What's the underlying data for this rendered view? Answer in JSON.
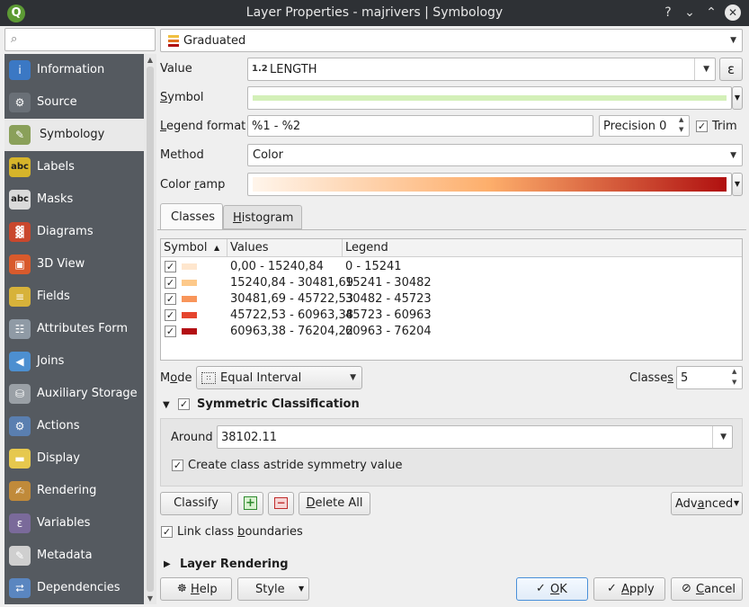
{
  "window": {
    "title": "Layer Properties - majrivers | Symbology",
    "logo_letter": "Q",
    "help_glyph": "?",
    "min_glyph": "⌄",
    "max_glyph": "⌃",
    "close_glyph": "✕"
  },
  "search": {
    "icon": "⌕",
    "placeholder": ""
  },
  "sidebar": {
    "items": [
      {
        "label": "Information",
        "icon": "info-icon",
        "glyph": "i",
        "color": "#3b78c4"
      },
      {
        "label": "Source",
        "icon": "source-icon",
        "glyph": "⚙",
        "color": "#6a7077"
      },
      {
        "label": "Symbology",
        "icon": "symbology-icon",
        "glyph": "✎",
        "color": "#8aa05a"
      },
      {
        "label": "Labels",
        "icon": "labels-icon",
        "glyph": "abc",
        "color": "#d6b42a"
      },
      {
        "label": "Masks",
        "icon": "masks-icon",
        "glyph": "abc",
        "color": "#dadada"
      },
      {
        "label": "Diagrams",
        "icon": "diagrams-icon",
        "glyph": "▓",
        "color": "#c9472d"
      },
      {
        "label": "3D View",
        "icon": "3d-view-icon",
        "glyph": "▣",
        "color": "#d85a2c"
      },
      {
        "label": "Fields",
        "icon": "fields-icon",
        "glyph": "≡",
        "color": "#d7b23a"
      },
      {
        "label": "Attributes Form",
        "icon": "attributes-form-icon",
        "glyph": "☷",
        "color": "#8f9aa5"
      },
      {
        "label": "Joins",
        "icon": "joins-icon",
        "glyph": "◀",
        "color": "#4d8fd0"
      },
      {
        "label": "Auxiliary Storage",
        "icon": "auxiliary-storage-icon",
        "glyph": "⛁",
        "color": "#9aa0a6"
      },
      {
        "label": "Actions",
        "icon": "actions-icon",
        "glyph": "⚙",
        "color": "#5a7fb0"
      },
      {
        "label": "Display",
        "icon": "display-icon",
        "glyph": "▬",
        "color": "#e6c84e"
      },
      {
        "label": "Rendering",
        "icon": "rendering-icon",
        "glyph": "✍",
        "color": "#c08a3a"
      },
      {
        "label": "Variables",
        "icon": "variables-icon",
        "glyph": "ε",
        "color": "#7a6a9a"
      },
      {
        "label": "Metadata",
        "icon": "metadata-icon",
        "glyph": "✎",
        "color": "#cfcfcf"
      },
      {
        "label": "Dependencies",
        "icon": "dependencies-icon",
        "glyph": "⮂",
        "color": "#5a86c0"
      }
    ],
    "active_index": 2
  },
  "renderer": {
    "value": "Graduated"
  },
  "value_field": {
    "label": "Value",
    "type_prefix": "1.2",
    "value": "LENGTH",
    "expr_glyph": "ε"
  },
  "symbol": {
    "label": "Symbol",
    "color": "#d3f0b8"
  },
  "legend_format": {
    "label": "Legend format",
    "value": "%1 - %2",
    "precision_label": "Precision 0",
    "trim_label": "Trim",
    "trim_checked": true
  },
  "method": {
    "label": "Method",
    "value": "Color"
  },
  "color_ramp": {
    "label": "Color ramp",
    "start": "#fff5eb",
    "mid": "#fdae6b",
    "end": "#b01010"
  },
  "tabs": [
    {
      "label": "Classes",
      "active": true
    },
    {
      "label": "Histogram",
      "active": false
    }
  ],
  "table": {
    "headers": [
      "Symbol",
      "Values",
      "Legend"
    ],
    "sort_glyph": "▲",
    "rows": [
      {
        "values": "0,00 - 15240,84",
        "legend": "0 - 15241",
        "color": "#fee6ce"
      },
      {
        "values": "15240,84 - 30481,69",
        "legend": "15241 - 30482",
        "color": "#fdc98a"
      },
      {
        "values": "30481,69 - 45722,53",
        "legend": "30482 - 45723",
        "color": "#f8955a"
      },
      {
        "values": "45722,53 - 60963,38",
        "legend": "45723 - 60963",
        "color": "#e5452e"
      },
      {
        "values": "60963,38 - 76204,22",
        "legend": "60963 - 76204",
        "color": "#b30f14"
      }
    ]
  },
  "mode": {
    "label": "Mode",
    "value": "Equal Interval",
    "classes_label": "Classes",
    "classes_value": "5"
  },
  "symmetric": {
    "label": "Symmetric Classification",
    "checked": true,
    "around_label": "Around",
    "around_value": "38102.11",
    "astride_label": "Create class astride symmetry value",
    "astride_checked": true
  },
  "buttons": {
    "classify": "Classify",
    "add_glyph": "+",
    "remove_glyph": "−",
    "delete_all": "Delete All",
    "advanced": "Advanced"
  },
  "link_boundaries": {
    "label": "Link class boundaries",
    "checked": true
  },
  "layer_rendering": {
    "label": "Layer Rendering"
  },
  "footer": {
    "help": "Help",
    "style": "Style",
    "ok": "OK",
    "apply": "Apply",
    "cancel": "Cancel"
  }
}
